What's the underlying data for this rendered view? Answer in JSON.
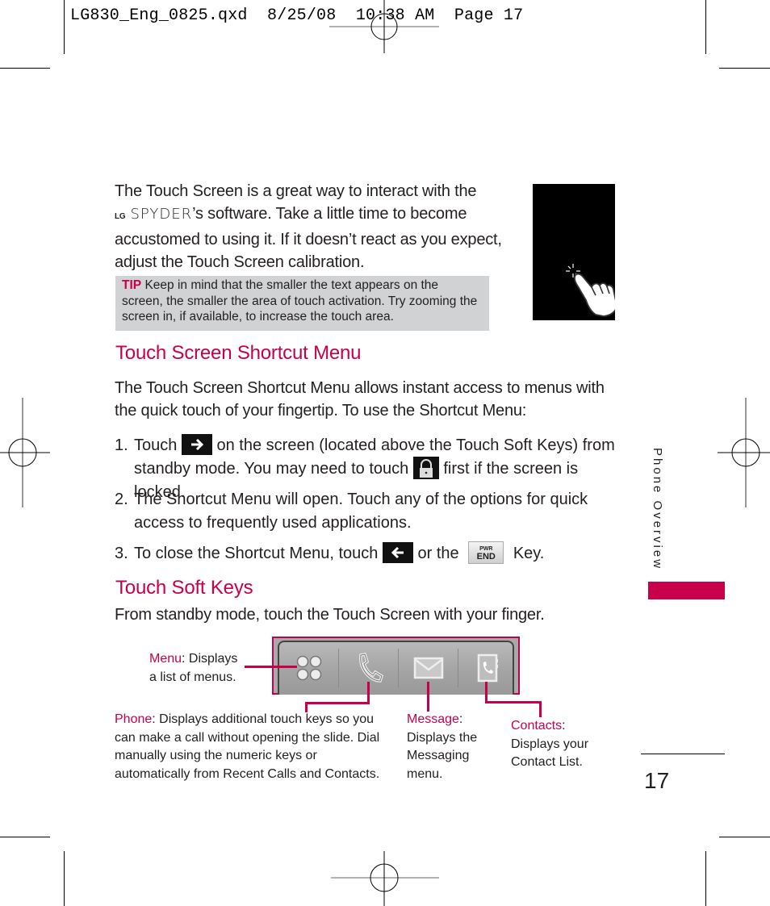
{
  "slug": {
    "text": "LG830_Eng_0825.qxd  8/25/08  10:38 AM  Page 17"
  },
  "intro": {
    "line1": "The Touch Screen is a great way to interact with the",
    "brand_prefix": "LG",
    "brand_name": "SPYDER",
    "line2_rest": "’s software. Take a little time to become",
    "line3": "accustomed to using it. If it doesn’t react as you expect,",
    "line4": "adjust the Touch Screen calibration."
  },
  "tip": {
    "label": "TIP",
    "text": "Keep in mind that the smaller the text appears on the screen, the smaller the area of touch activation. Try zooming the screen in, if available, to increase the touch area."
  },
  "touch_image": {
    "icon": "finger-touch-icon"
  },
  "section1": {
    "heading": "Touch Screen Shortcut Menu",
    "para_line1": "The Touch Screen Shortcut Menu allows instant access to menus with",
    "para_line2": "the quick touch of your fingertip. To use the Shortcut Menu:",
    "steps": [
      {
        "num": "1.",
        "a": "Touch",
        "icon1": "arrow-right-icon",
        "b": "on the screen (located above the Touch Soft Keys) from",
        "c": "standby mode. You may need to touch",
        "icon2": "lock-icon",
        "d": "first if the screen is locked."
      },
      {
        "num": "2.",
        "a": "The Shortcut Menu will open. Touch any of the options for quick",
        "b": "access to frequently used applications."
      },
      {
        "num": "3.",
        "a": "To close the Shortcut Menu, touch",
        "icon1": "arrow-left-icon",
        "b": "or the",
        "key_top": "PWR",
        "key_bottom": "END",
        "c": "Key."
      }
    ]
  },
  "section2": {
    "heading": "Touch Soft Keys",
    "intro": "From standby mode, touch the Touch Screen with your finger.",
    "keys": [
      {
        "name": "Menu",
        "icon": "menu-grid-icon",
        "desc_line1": ": Displays",
        "desc_line2": "a list of menus."
      },
      {
        "name": "Phone",
        "icon": "phone-icon",
        "desc_line1": ": Displays additional touch keys so you",
        "desc_line2": "can make a call without opening the slide. Dial",
        "desc_line3": "manually using the numeric keys or",
        "desc_line4": "automatically from Recent Calls and Contacts."
      },
      {
        "name": "Message",
        "icon": "envelope-icon",
        "desc_line1": ":",
        "desc_line2": "Displays the",
        "desc_line3": "Messaging",
        "desc_line4": "menu."
      },
      {
        "name": "Contacts",
        "icon": "contacts-book-icon",
        "desc_line1": ":",
        "desc_line2": "Displays your",
        "desc_line3": "Contact List."
      }
    ]
  },
  "sidebar": {
    "label": "Phone Overview",
    "accent": "#c8004b"
  },
  "page": {
    "number": "17"
  },
  "colors": {
    "accent": "#c8004b",
    "tip_bg": "#d1d2d4",
    "text": "#231f20"
  }
}
